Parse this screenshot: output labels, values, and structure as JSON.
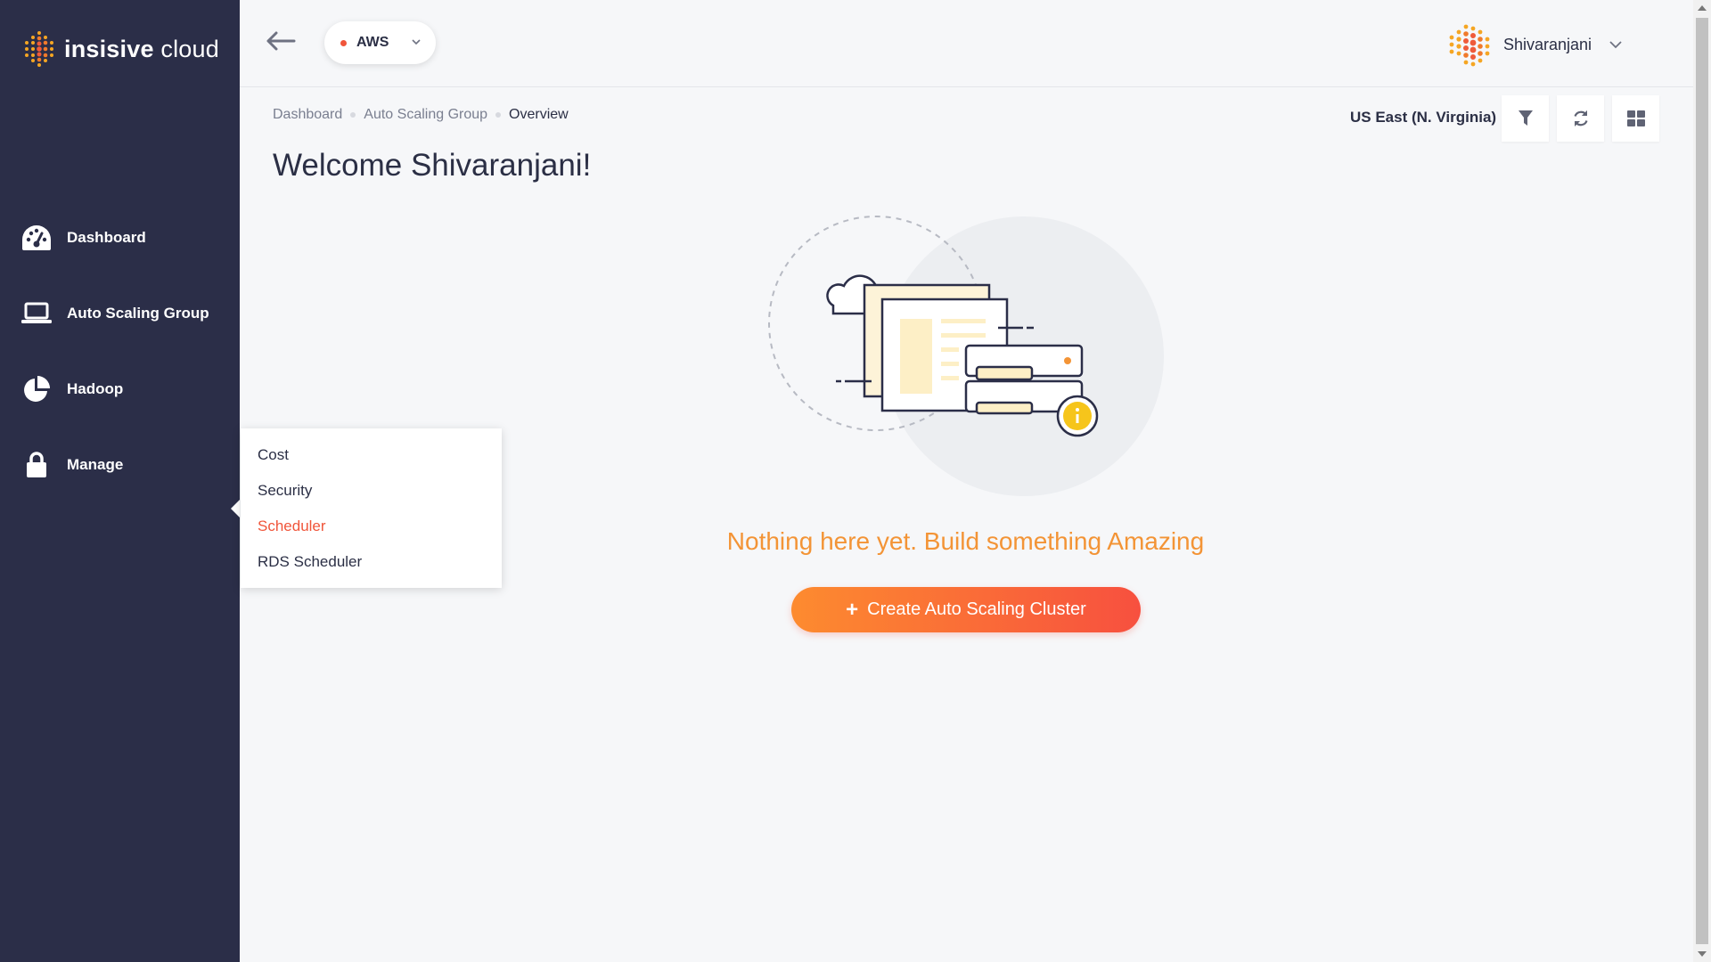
{
  "brand": {
    "bold": "insisive",
    "light": " cloud"
  },
  "sidebar": {
    "items": [
      {
        "label": "Dashboard",
        "icon": "dashboard-gauge-icon"
      },
      {
        "label": "Auto Scaling Group",
        "icon": "laptop-icon"
      },
      {
        "label": "Hadoop",
        "icon": "pie-chart-icon"
      },
      {
        "label": "Manage",
        "icon": "lock-icon"
      }
    ]
  },
  "flyout": {
    "items": [
      {
        "label": "Cost",
        "active": false
      },
      {
        "label": "Security",
        "active": false
      },
      {
        "label": "Scheduler",
        "active": true
      },
      {
        "label": "RDS Scheduler",
        "active": false
      }
    ]
  },
  "topbar": {
    "cloud": "AWS",
    "user": "Shivaranjani"
  },
  "breadcrumb": [
    "Dashboard",
    "Auto Scaling Group",
    "Overview"
  ],
  "region": "US East (N. Virginia)",
  "welcome": "Welcome Shivaranjani!",
  "empty": {
    "message": "Nothing here yet. Build something Amazing",
    "button": "Create Auto Scaling Cluster"
  },
  "colors": {
    "sidebar": "#2b2e48",
    "accent": "#f0553a",
    "message": "#f39436"
  }
}
